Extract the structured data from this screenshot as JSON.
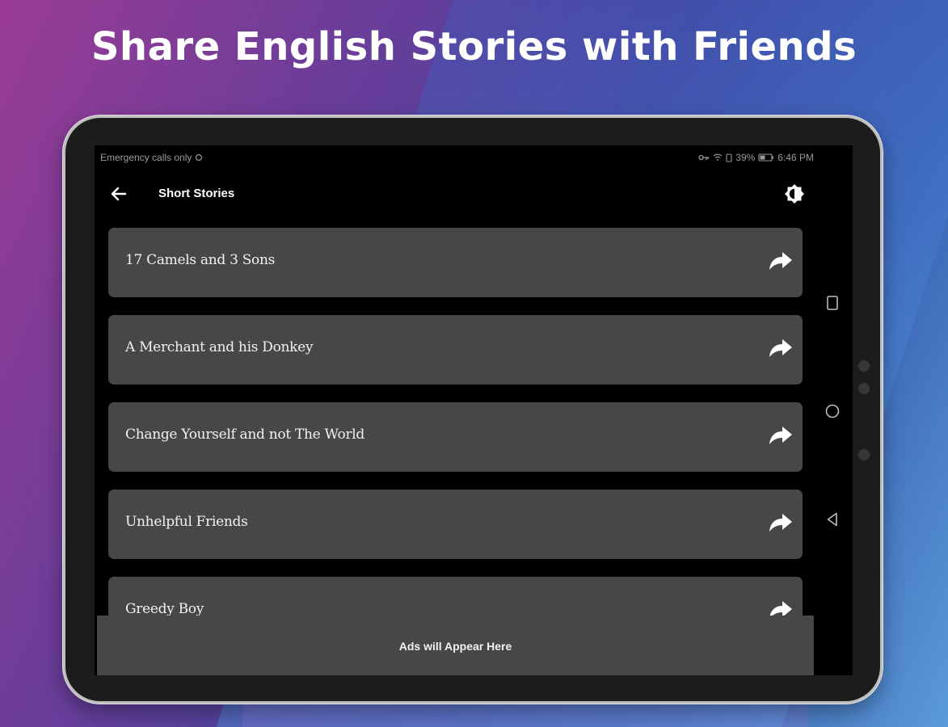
{
  "headline": "Share English Stories with Friends",
  "status_bar": {
    "left_text": "Emergency calls only",
    "battery": "39%",
    "time": "6:46 PM"
  },
  "app_bar": {
    "title": "Short Stories",
    "back_icon": "arrow-left-icon",
    "theme_icon": "brightness-icon"
  },
  "stories": [
    {
      "title": "17 Camels and 3 Sons"
    },
    {
      "title": "A Merchant and his Donkey"
    },
    {
      "title": "Change Yourself and not The World"
    },
    {
      "title": "Unhelpful Friends"
    },
    {
      "title": "Greedy Boy"
    }
  ],
  "ad_banner": {
    "text": "Ads will Appear Here"
  },
  "colors": {
    "card_background": "#474747",
    "screen_background": "#000000",
    "text": "#f1f1f1"
  }
}
